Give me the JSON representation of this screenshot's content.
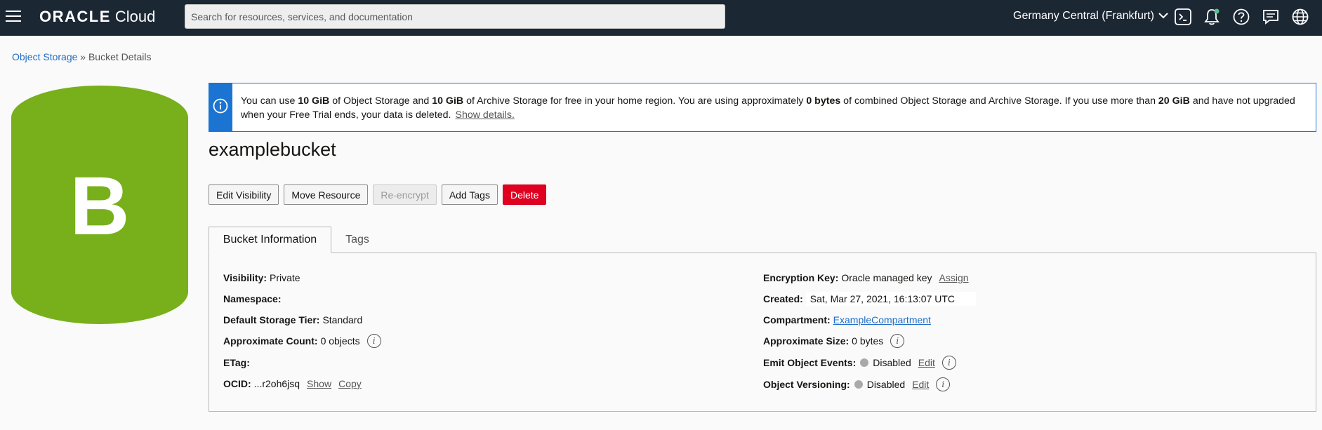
{
  "header": {
    "brand_oracle": "ORACLE",
    "brand_cloud": "Cloud",
    "search_placeholder": "Search for resources, services, and documentation",
    "region": "Germany Central (Frankfurt)",
    "icons": [
      "cloud-shell-icon",
      "notifications-icon",
      "help-icon",
      "feedback-icon",
      "language-icon"
    ]
  },
  "breadcrumb": {
    "parent": "Object Storage",
    "separator": "»",
    "current": "Bucket Details"
  },
  "bucket_icon": {
    "letter": "B",
    "color": "#77b01a"
  },
  "banner": {
    "t1": "You can use ",
    "b1": "10 GiB",
    "t2": " of Object Storage and ",
    "b2": "10 GiB",
    "t3": " of Archive Storage for free in your home region. You are using approximately ",
    "b3": "0 bytes",
    "t4": " of combined Object Storage and Archive Storage. If you use more than ",
    "b4": "20 GiB",
    "t5": " and have not upgraded when your Free Trial ends, your data is deleted.",
    "link": "Show details."
  },
  "title": "examplebucket",
  "actions": {
    "edit_visibility": "Edit Visibility",
    "move_resource": "Move Resource",
    "re_encrypt": "Re-encrypt",
    "add_tags": "Add Tags",
    "delete": "Delete"
  },
  "tabs": {
    "bucket_information": "Bucket Information",
    "tags": "Tags"
  },
  "details_left": {
    "visibility_label": "Visibility:",
    "visibility_value": "Private",
    "namespace_label": "Namespace:",
    "namespace_value": "",
    "storage_tier_label": "Default Storage Tier:",
    "storage_tier_value": "Standard",
    "approx_count_label": "Approximate Count:",
    "approx_count_value": "0 objects",
    "etag_label": "ETag:",
    "etag_value": "",
    "ocid_label": "OCID:",
    "ocid_value": "...r2oh6jsq",
    "ocid_show": "Show",
    "ocid_copy": "Copy"
  },
  "details_right": {
    "encryption_label": "Encryption Key:",
    "encryption_value": "Oracle managed key",
    "encryption_action": "Assign",
    "created_label": "Created:",
    "created_value": "Sat, Mar 27, 2021, 16:13:07 UTC",
    "compartment_label": "Compartment:",
    "compartment_value": "ExampleCompartment",
    "approx_size_label": "Approximate Size:",
    "approx_size_value": "0 bytes",
    "emit_events_label": "Emit Object Events:",
    "emit_events_value": "Disabled",
    "emit_events_action": "Edit",
    "versioning_label": "Object Versioning:",
    "versioning_value": "Disabled",
    "versioning_action": "Edit"
  }
}
